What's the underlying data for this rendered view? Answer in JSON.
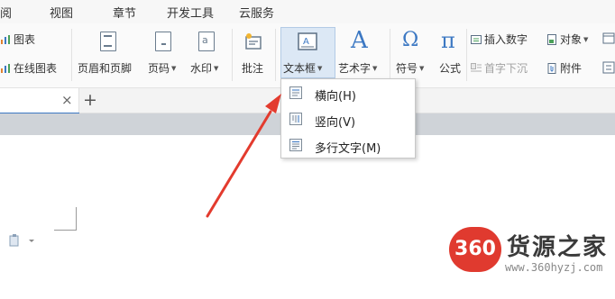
{
  "menu": {
    "tabs": [
      "阅",
      "视图",
      "章节",
      "开发工具",
      "云服务"
    ]
  },
  "ribbon": {
    "chart_label": "图表",
    "online_chart_label": "在线图表",
    "header_footer_label": "页眉和页脚",
    "page_number_label": "页码",
    "watermark_label": "水印",
    "comment_label": "批注",
    "textbox_label": "文本框",
    "wordart_label": "艺术字",
    "symbol_label": "符号",
    "formula_label": "公式",
    "insert_number_label": "插入数字",
    "object_label": "对象",
    "drop_cap_label": "首字下沉",
    "attachment_label": "附件",
    "wordart_glyph": "A",
    "symbol_glyph": "Ω",
    "formula_glyph": "π"
  },
  "doc_tabs": {
    "close_glyph": "×",
    "new_tab_glyph": "+"
  },
  "dropdown": {
    "items": [
      "横向(H)",
      "竖向(V)",
      "多行文字(M)"
    ]
  },
  "watermark": {
    "logo_text": "360",
    "brand": "货源之家",
    "url": "www.360hyzj.com"
  },
  "colors": {
    "arrow": "#e33b2e",
    "accent": "#3c78c3",
    "watermark_red": "#e03a2f"
  }
}
